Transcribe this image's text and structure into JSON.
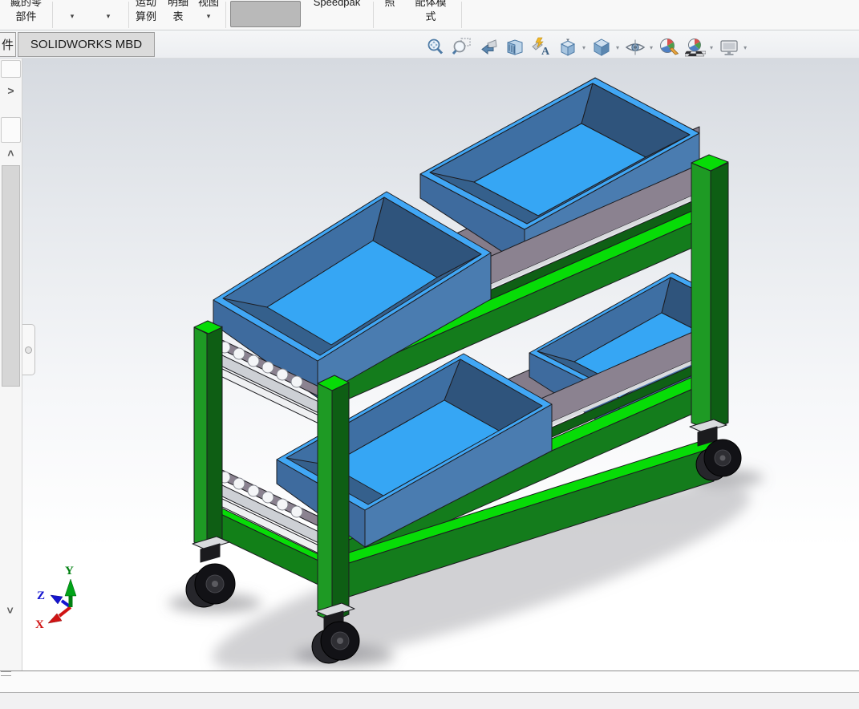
{
  "toolbar": {
    "show_hidden_components": {
      "line1": "藏的零",
      "line2": "部件"
    },
    "dropdown_a": {
      "arrow": "▾"
    },
    "dropdown_b": {
      "arrow": "▾"
    },
    "motion_study": {
      "line1": "运动",
      "line2": "算例"
    },
    "bom": {
      "line1": "明细",
      "line2": "表"
    },
    "view": {
      "line1": "视图",
      "arrow": "▾"
    },
    "speedpak": {
      "label": "Speedpak"
    },
    "snapshot": {
      "label": "照"
    },
    "large_assembly_mode": {
      "line1": "配体模",
      "line2": "式"
    }
  },
  "tabs": {
    "partial": "件",
    "mbd": "SOLIDWORKS MBD"
  },
  "headsup": {
    "icons": [
      "zoom-to-fit",
      "zoom-to-area",
      "previous-view",
      "section-view",
      "view-annotations",
      "view-orientation",
      "display-style",
      "hide-show-items",
      "edit-appearance",
      "apply-scene",
      "view-settings"
    ],
    "dropdown_after": [
      "view-orientation",
      "display-style",
      "hide-show-items",
      "apply-scene",
      "view-settings"
    ]
  },
  "triad": {
    "x": "X",
    "y": "Y",
    "z": "Z"
  },
  "scene": {
    "description": "Two-tier green flow-rack cart with four tilted blue bins on inclined roller lanes and black swivel casters",
    "bins_visible": 4,
    "casters_visible": 3,
    "roller_lanes_visible": 2,
    "colors": {
      "frame_green": "#1E9A24",
      "frame_green_dark": "#0E5E14",
      "frame_lime": "#07DC07",
      "panel_mauve": "#8B8290",
      "bin_rim_blue": "#41A7F5",
      "bin_side_blue": "#4A7CB0",
      "bin_side_dark": "#3E6B9E",
      "bin_inner": "#35608C",
      "bin_bottom": "#36A6F4",
      "roller_white": "#F4F5F7",
      "caster_black": "#121216",
      "metal_silver": "#D9DBDE",
      "background_top": "#D6DAE0",
      "background_bottom": "#FFFFFF",
      "axis_x_red": "#D01414",
      "axis_y_green": "#008010",
      "axis_z_blue": "#1515CF"
    }
  },
  "statusbar": {
    "text": ""
  }
}
